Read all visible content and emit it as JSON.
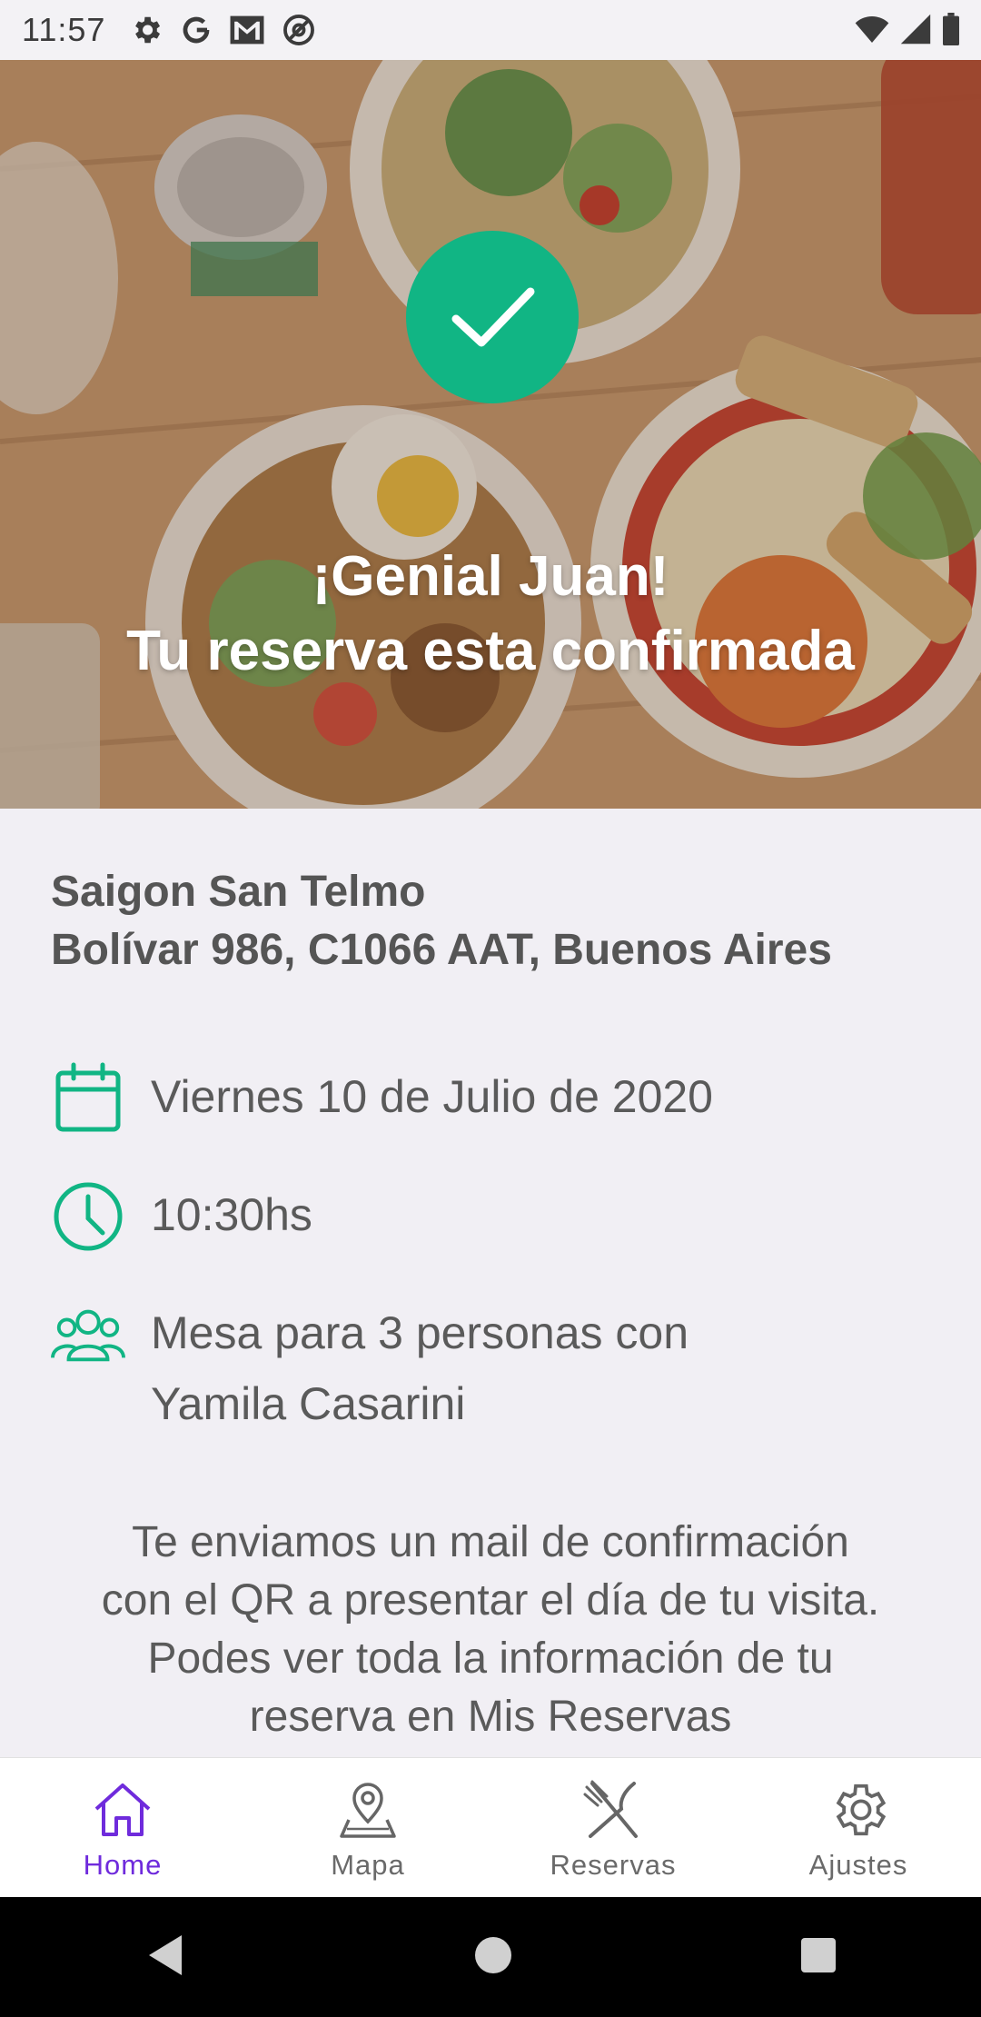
{
  "status_bar": {
    "time": "11:57"
  },
  "hero": {
    "title_line1": "¡Genial Juan!",
    "title_line2": "Tu reserva esta confirmada",
    "check_color": "#11b584"
  },
  "venue": {
    "name": "Saigon San Telmo",
    "address": "Bolívar 986, C1066 AAT, Buenos Aires"
  },
  "details": {
    "date": "Viernes 10 de Julio de 2020",
    "time": "10:30hs",
    "table_line1": "Mesa para 3 personas con",
    "table_line2": "Yamila Casarini",
    "icon_color": "#11b584"
  },
  "note": {
    "line1": "Te enviamos un mail de confirmación",
    "line2": "con el QR a presentar el día de tu visita.",
    "line3": "Podes ver toda la información de tu",
    "line4": "reserva en Mis Reservas"
  },
  "bottom_nav": {
    "items": [
      {
        "label": "Home",
        "icon": "home-icon",
        "active": true
      },
      {
        "label": "Mapa",
        "icon": "map-pin-icon",
        "active": false
      },
      {
        "label": "Reservas",
        "icon": "fork-knife-icon",
        "active": false
      },
      {
        "label": "Ajustes",
        "icon": "gear-icon",
        "active": false
      }
    ],
    "active_color": "#6f2bdc"
  }
}
